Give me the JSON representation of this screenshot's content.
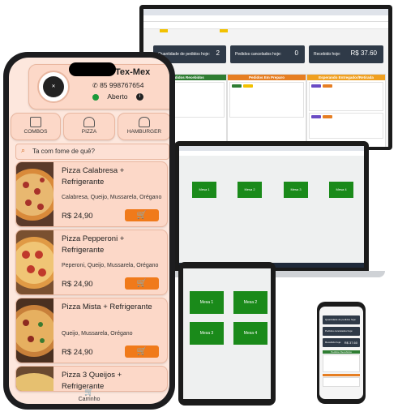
{
  "monitor": {
    "stats": [
      {
        "label": "Quantidade de pedidos hoje:",
        "value": "2"
      },
      {
        "label": "Pedidos cancelados hoje:",
        "value": "0"
      },
      {
        "label": "Recebido hoje:",
        "value": "R$ 37.60"
      }
    ],
    "columns": [
      {
        "title": "Pedidos Recebidos",
        "color": "#2e7d32"
      },
      {
        "title": "Pedidos Em Preparo",
        "color": "#e67e22"
      },
      {
        "title": "Esperando Entregador/Retirada",
        "color": "#f0a020"
      }
    ]
  },
  "laptop": {
    "tables": [
      "Mesa 1",
      "Mesa 2",
      "Mesa 3",
      "Mesa 4"
    ]
  },
  "tablet": {
    "tables": [
      "Mesa 1",
      "Mesa 2",
      "Mesa 3",
      "Mesa 4"
    ]
  },
  "small_phone": {
    "stats": [
      "Quantidade de pedidos hoje:",
      "Pedidos cancelados hoje:",
      "Recebido hoje:"
    ],
    "received_value": "R$ 37.60",
    "column_title": "Pedidos Recebidos"
  },
  "app": {
    "store_name": "Tex-Mex",
    "phone": "85 998767654",
    "status": "Aberto",
    "status_color": "#1a9a3a",
    "accent": "#f07a1a",
    "categories": [
      {
        "label": "COMBOS",
        "icon": "receipt-icon"
      },
      {
        "label": "PIZZA",
        "icon": "pizza-icon"
      },
      {
        "label": "HAMBURGER",
        "icon": "burger-icon"
      }
    ],
    "search_placeholder": "Ta com fome de quê?",
    "items": [
      {
        "name": "Pizza Calabresa + Refrigerante",
        "desc": "Calabresa, Queijo, Mussarela, Orégano",
        "price": "R$ 24,90"
      },
      {
        "name": "Pizza Pepperoni + Refrigerante",
        "desc": "Peperoni, Queijo, Mussarela, Orégano",
        "price": "R$ 24,90"
      },
      {
        "name": "Pizza Mista + Refrigerante",
        "desc": "Queijo, Mussarela, Orégano",
        "price": "R$ 24,90"
      },
      {
        "name": "Pizza 3 Queijos + Refrigerante",
        "desc": "",
        "price": ""
      }
    ],
    "cart_label": "Carrinho"
  }
}
